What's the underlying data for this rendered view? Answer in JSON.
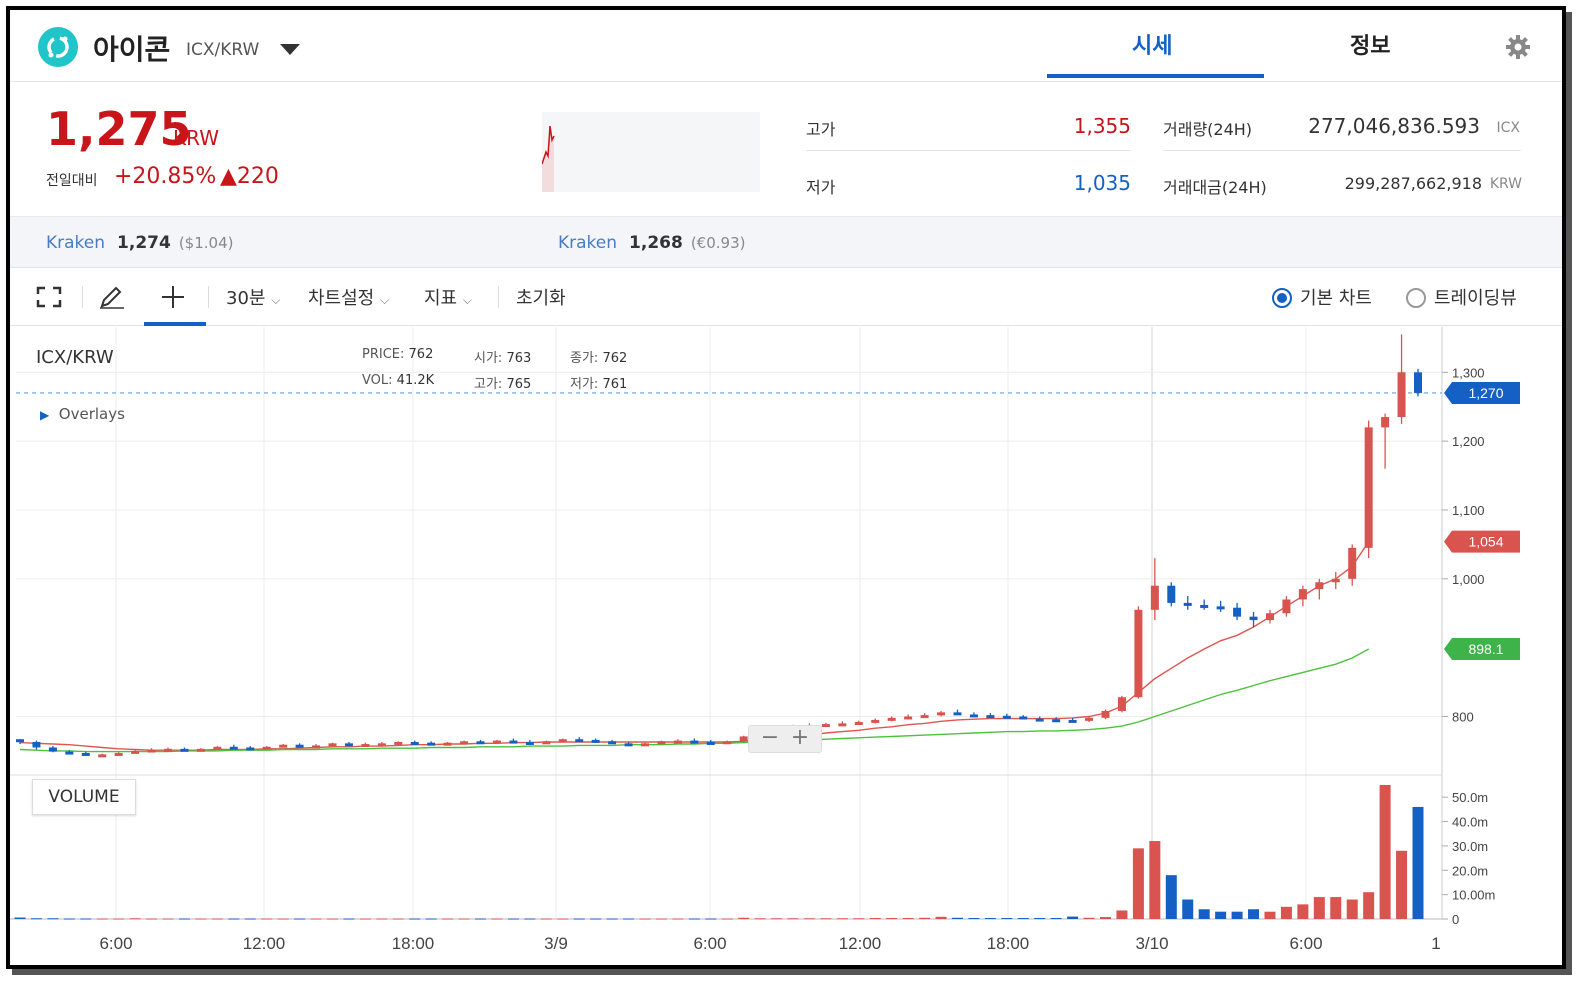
{
  "header": {
    "coin_name": "아이콘",
    "pair": "ICX/KRW",
    "tabs": [
      "시세",
      "정보"
    ],
    "icons": {
      "logo": "icx-logo-icon",
      "caret": "caret-down-icon",
      "settings": "gear-icon"
    }
  },
  "summary": {
    "price": "1,275",
    "unit": "KRW",
    "change_label": "전일대비",
    "change_pct": "+20.85%",
    "change_abs": "▲220",
    "high_label": "고가",
    "high": "1,355",
    "low_label": "저가",
    "low": "1,035",
    "volume_label": "거래량(24H)",
    "volume": "277,046,836.593",
    "volume_unit": "ICX",
    "value_label": "거래대금(24H)",
    "value": "299,287,662,918",
    "value_unit": "KRW",
    "colors": {
      "up": "#c8151a",
      "down": "#1261c4"
    }
  },
  "exchanges": [
    {
      "name": "Kraken",
      "price": "1,274",
      "sub": "($1.04)"
    },
    {
      "name": "Kraken",
      "price": "1,268",
      "sub": "(€0.93)"
    }
  ],
  "toolbar": {
    "interval": "30분",
    "chart_settings": "차트설정",
    "indicators": "지표",
    "reset": "초기화",
    "basic_chart": "기본 차트",
    "tradingview": "트레이딩뷰",
    "icons": [
      "fullscreen-icon",
      "pencil-icon",
      "crosshair-icon"
    ]
  },
  "chart": {
    "symbol": "ICX/KRW",
    "ohlc": {
      "price_label": "PRICE:",
      "price": "762",
      "open_label": "시가:",
      "open": "763",
      "close_label": "종가:",
      "close": "762",
      "vol_label": "VOL:",
      "vol": "41.2K",
      "high_label": "고가:",
      "high": "765",
      "low_label": "저가:",
      "low": "761"
    },
    "overlays": "Overlays",
    "volume_label": "VOLUME",
    "zoom_out": "−",
    "zoom_in": "+",
    "last_price_tag": "1,270",
    "ma1_tag": "1,054",
    "ma2_tag": "898.1"
  },
  "chart_data": {
    "type": "candlestick",
    "x_ticks": [
      "6:00",
      "12:00",
      "18:00",
      "3/9",
      "6:00",
      "12:00",
      "18:00",
      "3/10",
      "6:00",
      "1"
    ],
    "y_ticks": [
      800,
      1000,
      1100,
      1200,
      1300
    ],
    "y_tick_labels": [
      "800",
      "1,000",
      "1,100",
      "1,200",
      "1,300"
    ],
    "volume_ticks": [
      "50.0m",
      "40.0m",
      "30.0m",
      "20.0m",
      "10.00m",
      "0"
    ],
    "ylim": [
      715,
      1360
    ],
    "volume_max_m": 55,
    "candles": [
      [
        767,
        767,
        760,
        763
      ],
      [
        763,
        765,
        752,
        755
      ],
      [
        755,
        757,
        748,
        749
      ],
      [
        749,
        751,
        745,
        747
      ],
      [
        747,
        749,
        743,
        744
      ],
      [
        744,
        746,
        742,
        745
      ],
      [
        745,
        748,
        744,
        747
      ],
      [
        747,
        752,
        746,
        750
      ],
      [
        750,
        754,
        749,
        752
      ],
      [
        752,
        755,
        750,
        753
      ],
      [
        753,
        755,
        750,
        751
      ],
      [
        751,
        754,
        750,
        753
      ],
      [
        753,
        757,
        752,
        756
      ],
      [
        756,
        759,
        754,
        755
      ],
      [
        755,
        757,
        752,
        754
      ],
      [
        754,
        757,
        752,
        756
      ],
      [
        756,
        760,
        755,
        759
      ],
      [
        759,
        761,
        756,
        757
      ],
      [
        757,
        760,
        755,
        758
      ],
      [
        758,
        762,
        757,
        761
      ],
      [
        761,
        763,
        758,
        759
      ],
      [
        759,
        762,
        757,
        760
      ],
      [
        760,
        763,
        758,
        761
      ],
      [
        761,
        764,
        759,
        763
      ],
      [
        763,
        765,
        760,
        762
      ],
      [
        762,
        764,
        759,
        760
      ],
      [
        760,
        763,
        758,
        762
      ],
      [
        762,
        765,
        760,
        764
      ],
      [
        764,
        766,
        761,
        763
      ],
      [
        763,
        766,
        761,
        765
      ],
      [
        765,
        768,
        762,
        763
      ],
      [
        763,
        766,
        760,
        762
      ],
      [
        762,
        765,
        760,
        764
      ],
      [
        764,
        768,
        762,
        767
      ],
      [
        767,
        770,
        765,
        766
      ],
      [
        766,
        768,
        763,
        764
      ],
      [
        764,
        766,
        760,
        761
      ],
      [
        761,
        763,
        758,
        759
      ],
      [
        759,
        762,
        757,
        761
      ],
      [
        761,
        765,
        760,
        764
      ],
      [
        764,
        767,
        762,
        765
      ],
      [
        765,
        768,
        763,
        763
      ],
      [
        763,
        766,
        761,
        762
      ],
      [
        762,
        765,
        760,
        764
      ],
      [
        764,
        772,
        762,
        771
      ],
      [
        771,
        780,
        769,
        778
      ],
      [
        778,
        785,
        776,
        783
      ],
      [
        783,
        788,
        781,
        786
      ],
      [
        786,
        790,
        784,
        787
      ],
      [
        787,
        791,
        785,
        789
      ],
      [
        789,
        793,
        787,
        790
      ],
      [
        790,
        794,
        788,
        792
      ],
      [
        792,
        797,
        790,
        795
      ],
      [
        795,
        800,
        793,
        798
      ],
      [
        798,
        803,
        796,
        800
      ],
      [
        800,
        805,
        798,
        802
      ],
      [
        802,
        808,
        800,
        806
      ],
      [
        806,
        810,
        804,
        803
      ],
      [
        803,
        806,
        800,
        802
      ],
      [
        802,
        805,
        799,
        801
      ],
      [
        801,
        804,
        798,
        800
      ],
      [
        800,
        802,
        796,
        797
      ],
      [
        797,
        800,
        794,
        796
      ],
      [
        796,
        799,
        793,
        795
      ],
      [
        795,
        798,
        792,
        794
      ],
      [
        794,
        800,
        792,
        798
      ],
      [
        798,
        810,
        796,
        808
      ],
      [
        808,
        830,
        806,
        828
      ],
      [
        828,
        960,
        826,
        955
      ],
      [
        955,
        1030,
        940,
        990
      ],
      [
        990,
        995,
        960,
        965
      ],
      [
        965,
        975,
        955,
        962
      ],
      [
        962,
        970,
        955,
        960
      ],
      [
        960,
        968,
        952,
        958
      ],
      [
        958,
        965,
        940,
        945
      ],
      [
        945,
        952,
        930,
        940
      ],
      [
        940,
        955,
        935,
        950
      ],
      [
        950,
        975,
        945,
        970
      ],
      [
        970,
        990,
        960,
        985
      ],
      [
        985,
        1000,
        970,
        995
      ],
      [
        995,
        1010,
        985,
        1000
      ],
      [
        1000,
        1050,
        990,
        1045
      ],
      [
        1045,
        1230,
        1030,
        1220
      ],
      [
        1220,
        1240,
        1160,
        1235
      ],
      [
        1235,
        1355,
        1225,
        1300
      ],
      [
        1300,
        1305,
        1265,
        1270
      ]
    ],
    "volumes_m": [
      0.6,
      0.3,
      0.3,
      0.2,
      0.2,
      0.2,
      0.2,
      0.3,
      0.2,
      0.2,
      0.2,
      0.2,
      0.2,
      0.2,
      0.2,
      0.2,
      0.2,
      0.2,
      0.2,
      0.2,
      0.2,
      0.2,
      0.2,
      0.2,
      0.2,
      0.2,
      0.2,
      0.2,
      0.2,
      0.2,
      0.2,
      0.2,
      0.2,
      0.2,
      0.2,
      0.2,
      0.2,
      0.2,
      0.2,
      0.2,
      0.2,
      0.2,
      0.2,
      0.2,
      0.5,
      0.3,
      0.3,
      0.3,
      0.3,
      0.3,
      0.3,
      0.3,
      0.4,
      0.4,
      0.4,
      0.5,
      0.9,
      0.5,
      0.4,
      0.4,
      0.4,
      0.4,
      0.4,
      0.4,
      1.0,
      0.5,
      0.8,
      3.5,
      29,
      32,
      18,
      8,
      4,
      3,
      3,
      4,
      3,
      5,
      6,
      9,
      9,
      8,
      11,
      55,
      28,
      46
    ],
    "series": [
      {
        "name": "MA1",
        "color": "#e0564f",
        "values": [
          762,
          761,
          760,
          759,
          757,
          755,
          753,
          752,
          751,
          751,
          751,
          751,
          752,
          752,
          752,
          753,
          753,
          754,
          755,
          756,
          756,
          757,
          757,
          758,
          759,
          759,
          760,
          760,
          761,
          761,
          762,
          762,
          763,
          763,
          763,
          763,
          763,
          763,
          763,
          763,
          763,
          763,
          763,
          763,
          764,
          766,
          768,
          771,
          773,
          776,
          778,
          780,
          783,
          785,
          788,
          790,
          793,
          795,
          796,
          797,
          797,
          797,
          797,
          797,
          798,
          800,
          805,
          815,
          835,
          855,
          870,
          885,
          898,
          910,
          918,
          930,
          945,
          960,
          975,
          990,
          1000,
          1018,
          1054
        ]
      },
      {
        "name": "MA2",
        "color": "#4cc23b",
        "values": [
          752,
          751,
          750,
          750,
          749,
          749,
          749,
          749,
          749,
          749,
          750,
          750,
          750,
          751,
          751,
          751,
          752,
          752,
          752,
          753,
          753,
          753,
          754,
          754,
          754,
          755,
          755,
          755,
          756,
          756,
          756,
          757,
          757,
          757,
          758,
          758,
          758,
          759,
          759,
          759,
          760,
          760,
          761,
          761,
          762,
          763,
          764,
          765,
          766,
          767,
          768,
          769,
          770,
          771,
          772,
          773,
          774,
          775,
          776,
          777,
          778,
          778,
          779,
          779,
          780,
          781,
          783,
          786,
          792,
          800,
          808,
          816,
          824,
          832,
          838,
          845,
          852,
          858,
          864,
          870,
          876,
          885,
          898.1
        ]
      }
    ]
  }
}
